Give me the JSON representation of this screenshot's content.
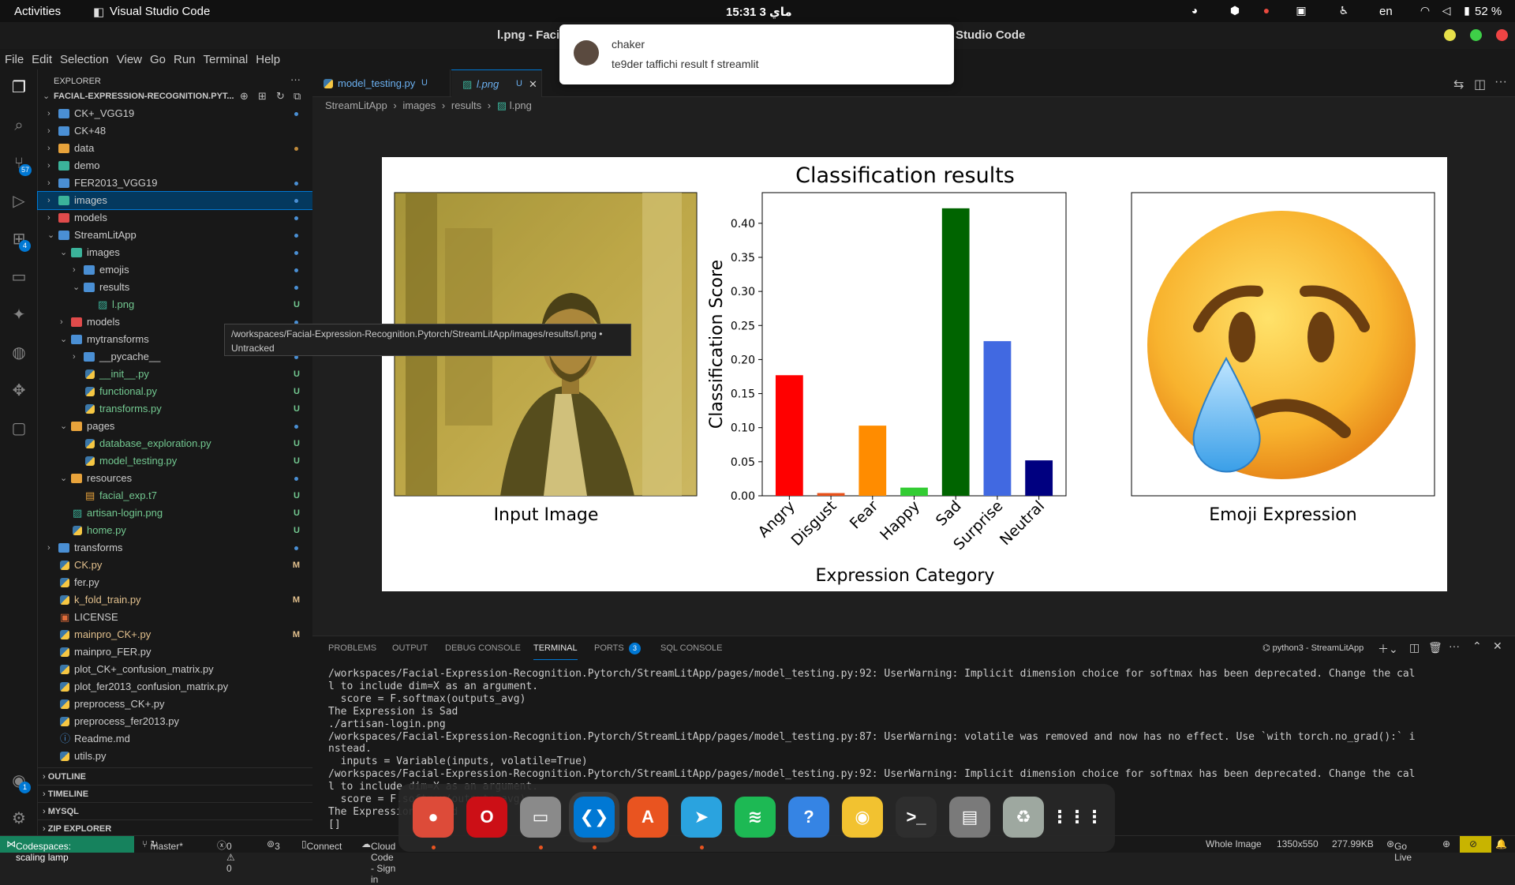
{
  "topbar": {
    "activities": "Activities",
    "app_name": "Visual Studio Code",
    "clock": "15:31  3 ماي",
    "lang": "en",
    "battery": "52 %"
  },
  "window": {
    "title": "l.png - Facial-Expression-Recognition.Pytorch [Codespaces: scaling lamp] - Visual Studio Code",
    "title_left": "l.png - Facia",
    "title_right": "Studio Code"
  },
  "menu": [
    "File",
    "Edit",
    "Selection",
    "View",
    "Go",
    "Run",
    "Terminal",
    "Help"
  ],
  "activitybar": {
    "source_control_badge": "57",
    "extensions_badge": "4",
    "accounts_badge": "1"
  },
  "explorer": {
    "header": "EXPLORER",
    "root": "FACIAL-EXPRESSION-RECOGNITION.PYT...",
    "items": [
      {
        "label": "CK+_VGG19",
        "kind": "folder",
        "depth": 0,
        "open": false,
        "status": "dot",
        "color": "#4a8fd4"
      },
      {
        "label": "CK+48",
        "kind": "folder",
        "depth": 0,
        "open": false,
        "status": "",
        "color": "#4a8fd4"
      },
      {
        "label": "data",
        "kind": "folder",
        "depth": 0,
        "open": false,
        "status": "dot-orange",
        "color": "#e8a33b"
      },
      {
        "label": "demo",
        "kind": "folder",
        "depth": 0,
        "open": false,
        "status": "",
        "color": "#3bb39a"
      },
      {
        "label": "FER2013_VGG19",
        "kind": "folder",
        "depth": 0,
        "open": false,
        "status": "dot",
        "color": "#4a8fd4"
      },
      {
        "label": "images",
        "kind": "folder",
        "depth": 0,
        "open": false,
        "status": "dot",
        "color": "#3bb39a",
        "selected": true
      },
      {
        "label": "models",
        "kind": "folder",
        "depth": 0,
        "open": false,
        "status": "dot",
        "color": "#e04b4b"
      },
      {
        "label": "StreamLitApp",
        "kind": "folder",
        "depth": 0,
        "open": true,
        "status": "dot",
        "color": "#4a8fd4"
      },
      {
        "label": "images",
        "kind": "folder",
        "depth": 1,
        "open": true,
        "status": "dot",
        "color": "#3bb39a"
      },
      {
        "label": "emojis",
        "kind": "folder",
        "depth": 2,
        "open": false,
        "status": "dot",
        "color": "#4a8fd4"
      },
      {
        "label": "results",
        "kind": "folder",
        "depth": 2,
        "open": true,
        "status": "dot",
        "color": "#4a8fd4"
      },
      {
        "label": "l.png",
        "kind": "image",
        "depth": 3,
        "status": "U"
      },
      {
        "label": "models",
        "kind": "folder",
        "depth": 1,
        "open": false,
        "status": "dot",
        "color": "#e04b4b"
      },
      {
        "label": "mytransforms",
        "kind": "folder",
        "depth": 1,
        "open": true,
        "status": "dot",
        "color": "#4a8fd4"
      },
      {
        "label": "__pycache__",
        "kind": "folder",
        "depth": 2,
        "open": false,
        "status": "dot",
        "color": "#4a8fd4"
      },
      {
        "label": "__init__.py",
        "kind": "py",
        "depth": 2,
        "status": "U"
      },
      {
        "label": "functional.py",
        "kind": "py",
        "depth": 2,
        "status": "U"
      },
      {
        "label": "transforms.py",
        "kind": "py",
        "depth": 2,
        "status": "U"
      },
      {
        "label": "pages",
        "kind": "folder",
        "depth": 1,
        "open": true,
        "status": "dot",
        "color": "#e8a33b"
      },
      {
        "label": "database_exploration.py",
        "kind": "py",
        "depth": 2,
        "status": "U"
      },
      {
        "label": "model_testing.py",
        "kind": "py",
        "depth": 2,
        "status": "U"
      },
      {
        "label": "resources",
        "kind": "folder",
        "depth": 1,
        "open": true,
        "status": "dot",
        "color": "#e8a33b"
      },
      {
        "label": "facial_exp.t7",
        "kind": "file",
        "depth": 2,
        "status": "U"
      },
      {
        "label": "artisan-login.png",
        "kind": "image",
        "depth": 1,
        "status": "U"
      },
      {
        "label": "home.py",
        "kind": "py",
        "depth": 1,
        "status": "U"
      },
      {
        "label": "transforms",
        "kind": "folder",
        "depth": 0,
        "open": false,
        "status": "dot",
        "color": "#4a8fd4"
      },
      {
        "label": "CK.py",
        "kind": "py",
        "depth": 0,
        "status": "M"
      },
      {
        "label": "fer.py",
        "kind": "py",
        "depth": 0,
        "status": ""
      },
      {
        "label": "k_fold_train.py",
        "kind": "py",
        "depth": 0,
        "status": "M"
      },
      {
        "label": "LICENSE",
        "kind": "license",
        "depth": 0,
        "status": ""
      },
      {
        "label": "mainpro_CK+.py",
        "kind": "py",
        "depth": 0,
        "status": "M"
      },
      {
        "label": "mainpro_FER.py",
        "kind": "py",
        "depth": 0,
        "status": ""
      },
      {
        "label": "plot_CK+_confusion_matrix.py",
        "kind": "py",
        "depth": 0,
        "status": ""
      },
      {
        "label": "plot_fer2013_confusion_matrix.py",
        "kind": "py",
        "depth": 0,
        "status": ""
      },
      {
        "label": "preprocess_CK+.py",
        "kind": "py",
        "depth": 0,
        "status": ""
      },
      {
        "label": "preprocess_fer2013.py",
        "kind": "py",
        "depth": 0,
        "status": ""
      },
      {
        "label": "Readme.md",
        "kind": "info",
        "depth": 0,
        "status": ""
      },
      {
        "label": "utils.py",
        "kind": "py",
        "depth": 0,
        "status": ""
      }
    ],
    "sections": [
      "OUTLINE",
      "TIMELINE",
      "MYSQL",
      "ZIP EXPLORER"
    ]
  },
  "tabs": [
    {
      "label": "model_testing.py",
      "status": "U",
      "active": false
    },
    {
      "label": "l.png",
      "status": "U",
      "active": true
    }
  ],
  "breadcrumb": [
    "StreamLitApp",
    "images",
    "results",
    "l.png"
  ],
  "tooltip": {
    "path": "/workspaces/Facial-Expression-Recognition.Pytorch/StreamLitApp/images/results/l.png •",
    "state": "Untracked"
  },
  "notification": {
    "sender": "chaker",
    "message": "te9der taffichi result f streamlit"
  },
  "figure": {
    "title": "Classification results",
    "left_caption": "Input Image",
    "right_caption": "Emoji Expression"
  },
  "chart_data": {
    "type": "bar",
    "title": "Classification results",
    "xlabel": "Expression Category",
    "ylabel": "Classification Score",
    "categories": [
      "Angry",
      "Disgust",
      "Fear",
      "Happy",
      "Sad",
      "Surprise",
      "Neutral"
    ],
    "values": [
      0.177,
      0.004,
      0.103,
      0.012,
      0.422,
      0.227,
      0.052
    ],
    "colors": [
      "#ff0000",
      "#e8511a",
      "#ff8c00",
      "#33cc33",
      "#006400",
      "#4169e1",
      "#000080"
    ],
    "ylim": [
      0,
      0.445
    ],
    "yticks": [
      "0.00",
      "0.05",
      "0.10",
      "0.15",
      "0.20",
      "0.25",
      "0.30",
      "0.35",
      "0.40"
    ],
    "ytick_values": [
      0,
      0.05,
      0.1,
      0.15,
      0.2,
      0.25,
      0.3,
      0.35,
      0.4
    ]
  },
  "panel": {
    "tabs": [
      "PROBLEMS",
      "OUTPUT",
      "DEBUG CONSOLE",
      "TERMINAL",
      "PORTS",
      "SQL CONSOLE"
    ],
    "ports_badge": "3",
    "terminal_name": "python3 - StreamLitApp",
    "lines": [
      "/workspaces/Facial-Expression-Recognition.Pytorch/StreamLitApp/pages/model_testing.py:92: UserWarning: Implicit dimension choice for softmax has been deprecated. Change the cal",
      "l to include dim=X as an argument.",
      "  score = F.softmax(outputs_avg)",
      "The Expression is Sad",
      "./artisan-login.png",
      "/workspaces/Facial-Expression-Recognition.Pytorch/StreamLitApp/pages/model_testing.py:87: UserWarning: volatile was removed and now has no effect. Use `with torch.no_grad():` i",
      "nstead.",
      "  inputs = Variable(inputs, volatile=True)",
      "/workspaces/Facial-Expression-Recognition.Pytorch/StreamLitApp/pages/model_testing.py:92: UserWarning: Implicit dimension choice for softmax has been deprecated. Change the cal",
      "l to include dim=X as an argument.",
      "  score = F.softmax(outputs_avg)",
      "The Expression is Sad",
      "[]"
    ]
  },
  "status": {
    "remote": "Codespaces: scaling lamp",
    "branch": "master*",
    "problems": "0 ⚠ 0",
    "ports": "3",
    "connect": "Connect",
    "cloud": "Cloud Code - Sign in",
    "whole": "Whole Image",
    "size": "1350x550",
    "filesize": "277.99KB",
    "golive": "Go Live"
  },
  "dock": [
    {
      "name": "chrome",
      "color": "#dd4b39",
      "glyph": "●"
    },
    {
      "name": "opera",
      "color": "#cc0f16",
      "glyph": "O"
    },
    {
      "name": "files",
      "color": "#8a8a8a",
      "glyph": "▭"
    },
    {
      "name": "vscode",
      "color": "#0078d4",
      "glyph": "❮❯"
    },
    {
      "name": "app-center",
      "color": "#e95420",
      "glyph": "A"
    },
    {
      "name": "telegram",
      "color": "#2aa3df",
      "glyph": "➤"
    },
    {
      "name": "spotify",
      "color": "#1db954",
      "glyph": "≋"
    },
    {
      "name": "help",
      "color": "#3584e4",
      "glyph": "?"
    },
    {
      "name": "rhythmbox",
      "color": "#f2c230",
      "glyph": "◉"
    },
    {
      "name": "terminal",
      "color": "#2e2e2e",
      "glyph": ">_"
    },
    {
      "name": "disks",
      "color": "#7a7a7a",
      "glyph": "▤"
    },
    {
      "name": "trash",
      "color": "#9ea8a0",
      "glyph": "♻"
    },
    {
      "name": "show-apps",
      "color": "transparent",
      "glyph": "⋮⋮⋮"
    }
  ]
}
